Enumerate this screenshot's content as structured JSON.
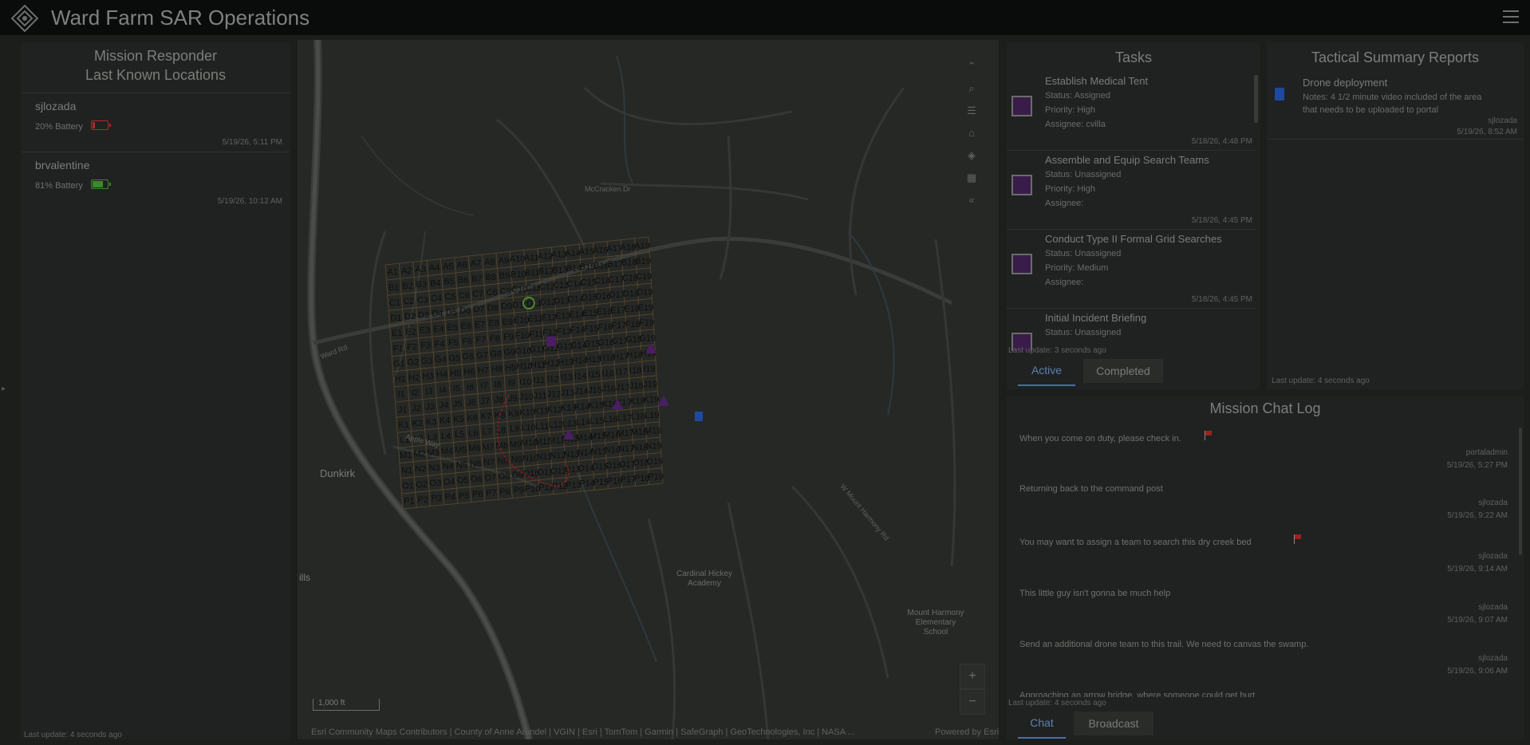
{
  "header": {
    "title": "Ward Farm SAR Operations"
  },
  "left_panel": {
    "title_line1": "Mission Responder",
    "title_line2": "Last Known Locations",
    "responders": [
      {
        "name": "sjlozada",
        "battery": "20% Battery",
        "battery_level": 0.2,
        "battery_color": "#b3262b",
        "time": "5/19/26, 5:11 PM"
      },
      {
        "name": "brvalentine",
        "battery": "81% Battery",
        "battery_level": 0.81,
        "battery_color": "#3b8a2b",
        "time": "5/19/26, 10:12 AM"
      }
    ],
    "last_update": "Last update: 4 seconds ago"
  },
  "map": {
    "labels": {
      "dunkirk": "Dunkirk",
      "hills": "ills",
      "academy_l1": "Cardinal Hickey",
      "academy_l2": "Academy",
      "school_l1": "Mount Harmony",
      "school_l2": "Elementary",
      "school_l3": "School",
      "mccracken": "McCracken Dr",
      "ward_rd": "Ward Rd",
      "apple_way": "Apple Way",
      "mt_harmony_rd": "W Mount Harmony Rd"
    },
    "scale": "1,000 ft",
    "attribution": "Esri Community Maps Contributors | County of Anne Arundel | VGIN | Esri | TomTom | Garmin | SafeGraph | GeoTechnologies, Inc | NASA ...",
    "powered_by": "Powered by Esri",
    "tools": [
      "chevrons-up-icon",
      "search-icon",
      "list-icon",
      "home-icon",
      "layers-icon",
      "grid-icon",
      "chevrons-left-icon"
    ],
    "zoom_in": "+",
    "zoom_out": "−",
    "grid_rows": [
      "A",
      "B",
      "C",
      "D",
      "E",
      "F",
      "G",
      "H",
      "I",
      "J",
      "K",
      "L",
      "M",
      "N",
      "O",
      "P"
    ]
  },
  "tasks": {
    "title": "Tasks",
    "items": [
      {
        "title": "Establish Medical Tent",
        "status": "Status:  Assigned",
        "priority": "Priority:  High",
        "assignee": "Assignee:  cvilla",
        "time": "5/18/26, 4:48 PM"
      },
      {
        "title": "Assemble and Equip Search Teams",
        "status": "Status:  Unassigned",
        "priority": "Priority:  High",
        "assignee": "Assignee:",
        "time": "5/18/26, 4:45 PM"
      },
      {
        "title": "Conduct Type II Formal Grid Searches",
        "status": "Status:  Unassigned",
        "priority": "Priority:  Medium",
        "assignee": "Assignee:",
        "time": "5/18/26, 4:45 PM"
      },
      {
        "title": "Initial Incident Briefing",
        "status": "Status:  Unassigned",
        "priority": "",
        "assignee": "",
        "time": ""
      }
    ],
    "last_update": "Last update: 3 seconds ago",
    "tabs": [
      "Active",
      "Completed"
    ]
  },
  "tactical": {
    "title": "Tactical Summary Reports",
    "report_title": "Drone deployment",
    "report_notes_l1": "Notes: 4 1/2 minute video included of the area",
    "report_notes_l2": "that needs to be uploaded to portal",
    "report_user": "sjlozada",
    "report_time": "5/19/26, 8:52 AM",
    "last_update": "Last update: 4 seconds ago"
  },
  "chat": {
    "title": "Mission Chat Log",
    "messages": [
      {
        "text": "When you come on duty, please check in.",
        "user": "portaladmin",
        "time": "5/19/26, 5:27 PM",
        "flag": true
      },
      {
        "text": "Returning back to the command post",
        "user": "sjlozada",
        "time": "5/19/26, 9:22 AM",
        "flag": false
      },
      {
        "text": "You may want to assign a team to search this dry creek bed",
        "user": "sjlozada",
        "time": "5/19/26, 9:14 AM",
        "flag": true
      },
      {
        "text": "This little guy isn't gonna be much help",
        "user": "sjlozada",
        "time": "5/19/26, 9:07 AM",
        "flag": false
      },
      {
        "text": "Send an additional drone team to this trail. We need to canvas the swamp.",
        "user": "sjlozada",
        "time": "5/19/26, 9:06 AM",
        "flag": false
      },
      {
        "text": "Approaching an arrow bridge, where someone could get hurt",
        "user": "",
        "time": "",
        "flag": false
      }
    ],
    "last_update": "Last update: 4 seconds ago",
    "tabs": [
      "Chat",
      "Broadcast"
    ]
  },
  "colors": {
    "accent": "#466ea8",
    "task_box": "#3a1c4a",
    "flag": "#a01e1e"
  }
}
